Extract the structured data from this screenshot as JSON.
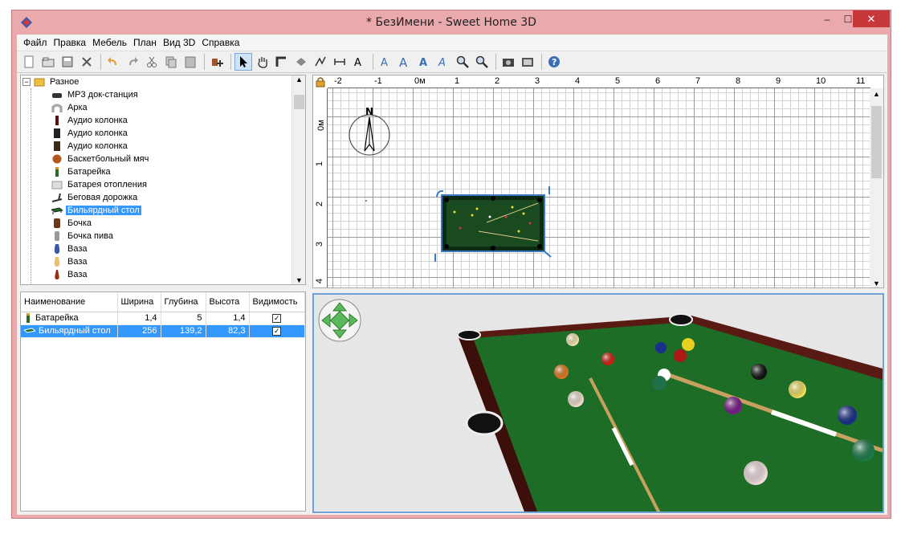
{
  "window": {
    "title": "* БезИмени - Sweet Home 3D",
    "controls": {
      "minimize": "‒",
      "maximize": "☐",
      "close": "✕"
    }
  },
  "menu": [
    "Файл",
    "Правка",
    "Мебель",
    "План",
    "Вид 3D",
    "Справка"
  ],
  "toolbar": {
    "buttons": [
      "new-icon",
      "open-icon",
      "save-icon",
      "cut-tool-icon",
      "undo-icon",
      "redo-icon",
      "cut-icon",
      "copy-icon",
      "paste-icon",
      "add-furniture-icon",
      "select-icon",
      "pan-icon",
      "create-walls-icon",
      "create-rooms-icon",
      "create-polylines-icon",
      "create-dimensions-icon",
      "add-text-icon",
      "text-style-icon",
      "text-bold-icon",
      "text-italic-icon",
      "text-size-icon",
      "zoom-in-icon",
      "zoom-out-icon",
      "photo-icon",
      "video-icon",
      "help-icon"
    ],
    "active": "select-icon"
  },
  "catalog": {
    "category": "Разное",
    "items": [
      "MP3 док-станция",
      "Арка",
      "Аудио колонка",
      "Аудио колонка",
      "Аудио колонка",
      "Баскетбольный мяч",
      "Батарейка",
      "Батарея отопления",
      "Беговая дорожка",
      "Бильярдный стол",
      "Бочка",
      "Бочка пива",
      "Ваза",
      "Ваза",
      "Ваза"
    ],
    "selected_index": 9
  },
  "furniture_table": {
    "columns": [
      "Наименование",
      "Ширина",
      "Глубина",
      "Высота",
      "Видимость"
    ],
    "rows": [
      {
        "name": "Батарейка",
        "width": "1,4",
        "depth": "5",
        "height": "1,4",
        "visible": "✓"
      },
      {
        "name": "Бильярдный стол",
        "width": "256",
        "depth": "139,2",
        "height": "82,3",
        "visible": "✓"
      }
    ],
    "selected_index": 1
  },
  "plan": {
    "ruler_x": [
      "-2",
      "-1",
      "0м",
      "1",
      "2",
      "3",
      "4",
      "5",
      "6",
      "7",
      "8",
      "9",
      "10",
      "11"
    ],
    "ruler_y": [
      "0м",
      "1",
      "2",
      "3",
      "4"
    ],
    "compass_label": "N"
  },
  "colors": {
    "table_felt": "#1d6d27",
    "table_rail": "#5a1a14",
    "selection": "#3399ff",
    "title_bar": "#e9a9ad"
  }
}
